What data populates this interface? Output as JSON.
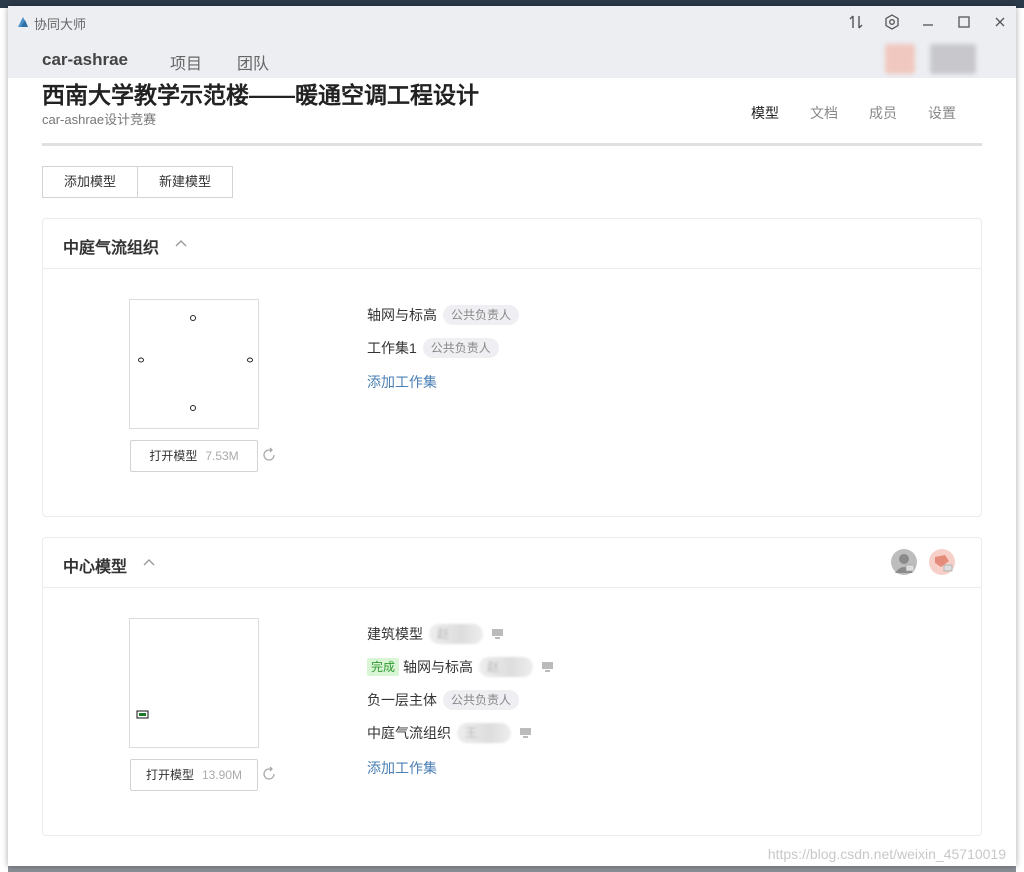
{
  "window": {
    "app_title": "协同大师",
    "controls": [
      "sync-icon",
      "settings-icon",
      "minimize-icon",
      "maximize-icon",
      "close-icon"
    ]
  },
  "topnav": {
    "brand": "car-ashrae",
    "items": [
      "项目",
      "团队"
    ]
  },
  "project": {
    "title": "西南大学教学示范楼——暖通空调工程设计",
    "subtitle": "car-ashrae设计竞赛"
  },
  "page_tabs": [
    {
      "label": "模型",
      "active": true
    },
    {
      "label": "文档",
      "active": false
    },
    {
      "label": "成员",
      "active": false
    },
    {
      "label": "设置",
      "active": false
    }
  ],
  "toolbar": {
    "add_model": "添加模型",
    "new_model": "新建模型"
  },
  "models": [
    {
      "title": "中庭气流组织",
      "open_label": "打开模型",
      "size": "7.53M",
      "worksets": [
        {
          "name": "轴网与标高",
          "owner": "公共负责人"
        },
        {
          "name": "工作集1",
          "owner": "公共负责人"
        }
      ],
      "add_workset": "添加工作集"
    },
    {
      "title": "中心模型",
      "open_label": "打开模型",
      "size": "13.90M",
      "worksets": [
        {
          "name": "建筑模型",
          "owner": "赵"
        },
        {
          "name": "轴网与标高",
          "owner": "赵",
          "status": "完成"
        },
        {
          "name": "负一层主体",
          "owner": "公共负责人"
        },
        {
          "name": "中庭气流组织",
          "owner": "王"
        }
      ],
      "add_workset": "添加工作集"
    }
  ],
  "watermark": "https://blog.csdn.net/weixin_45710019"
}
